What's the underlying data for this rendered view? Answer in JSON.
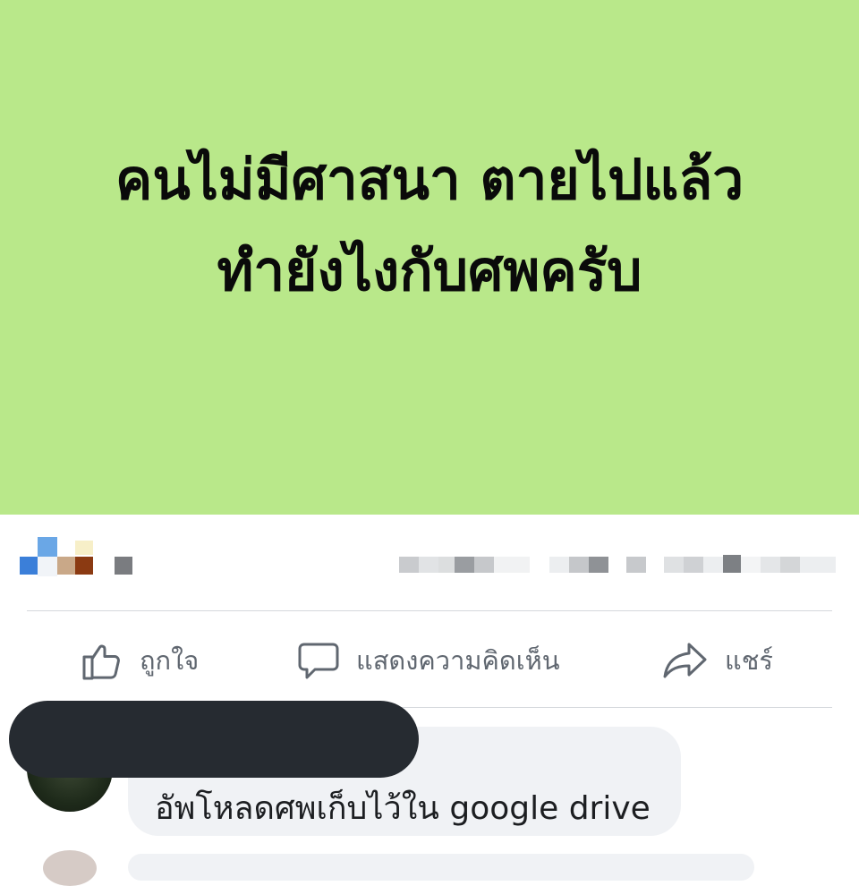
{
  "post": {
    "background_color": "#b9e88a",
    "text_line_1": "คนไม่มีศาสนา ตายไปแล้ว",
    "text_line_2": "ทำยังไงกับศพครับ"
  },
  "actions": {
    "like_label": "ถูกใจ",
    "comment_label": "แสดงความคิดเห็น",
    "share_label": "แชร์",
    "like_icon": "thumbs-up-icon",
    "comment_icon": "speech-bubble-icon",
    "share_icon": "share-arrow-icon"
  },
  "comment": {
    "text": "อัพโหลดศพเก็บไว้ใน google drive",
    "author_redacted": true
  }
}
